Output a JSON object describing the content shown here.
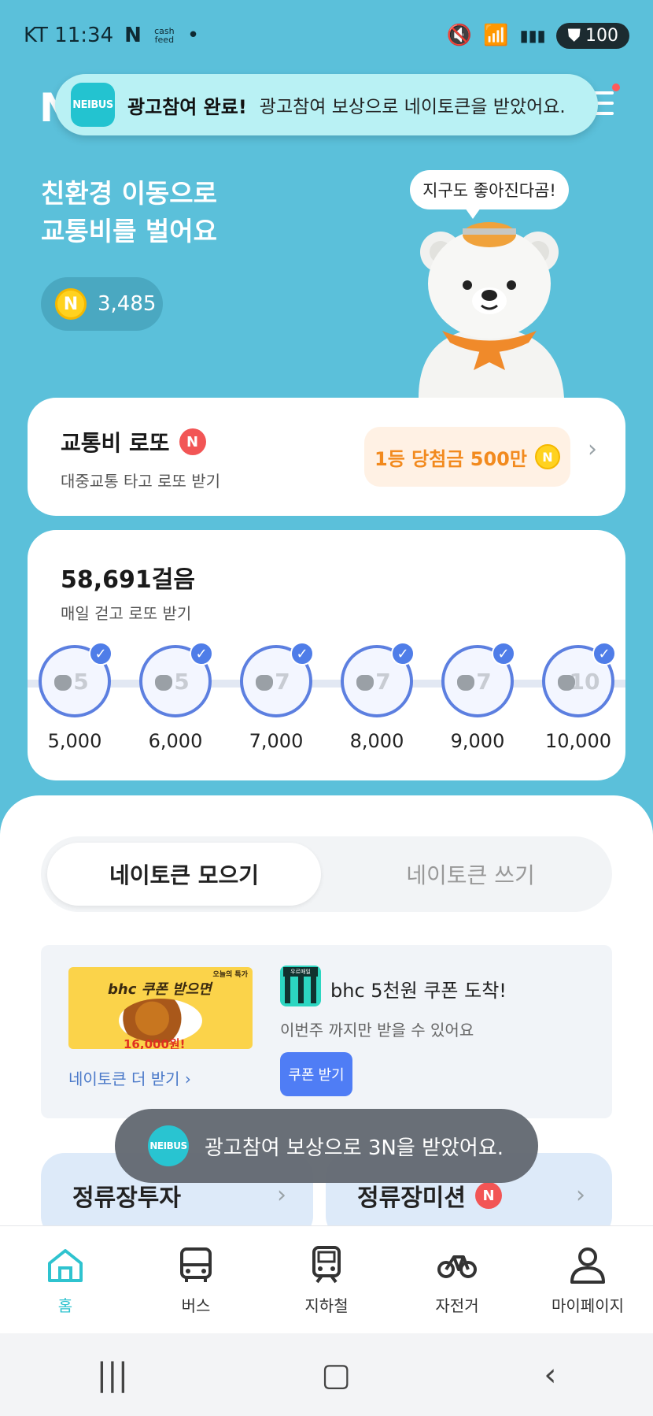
{
  "status_bar": {
    "carrier_time": "KT 11:34",
    "left_icons": [
      "N",
      "cash feed"
    ],
    "battery": "100"
  },
  "header": {
    "logo_partial": "N"
  },
  "toast_top": {
    "app_icon_text": "NEIBUS",
    "bold": "광고참여 완료!",
    "message": "광고참여 보상으로 네이토큰을 받았어요."
  },
  "hero": {
    "title_line1": "친환경 이동으로",
    "title_line2": "교통비를 벌어요",
    "coin_letter": "N",
    "points": "3,485",
    "bubble": "지구도 좋아진다곰!"
  },
  "lotto": {
    "title": "교통비 로또",
    "badge": "N",
    "subtitle": "대중교통 타고 로또 받기",
    "prize": "1등 당첨금 500만",
    "prize_coin": "N"
  },
  "walk": {
    "title": "58,691걸음",
    "subtitle": "매일 걷고 로또 받기",
    "steps": [
      {
        "reward": "5",
        "label": "5,000"
      },
      {
        "reward": "5",
        "label": "6,000"
      },
      {
        "reward": "7",
        "label": "7,000"
      },
      {
        "reward": "7",
        "label": "8,000"
      },
      {
        "reward": "7",
        "label": "9,000"
      },
      {
        "reward": "10",
        "label": "10,000"
      }
    ]
  },
  "tabs": {
    "active": "네이토큰 모으기",
    "inactive": "네이토큰 쓰기"
  },
  "ad": {
    "banner_title": "bhc 쿠폰 받으면",
    "banner_brand": "오늘의 특가",
    "banner_price": "16,000원!",
    "more_link": "네이토큰 더 받기",
    "app_label": "우르매일",
    "title": "bhc 5천원 쿠폰 도착!",
    "subtitle": "이번주 까지만 받을 수 있어요",
    "button": "쿠폰 받기"
  },
  "mini_cards": {
    "left": "정류장투자",
    "right": "정류장미션",
    "right_badge": "N"
  },
  "toast_bottom": {
    "app_icon_text": "NEIBUS",
    "message": "광고참여 보상으로 3N을 받았어요."
  },
  "bottom_nav": {
    "home": "홈",
    "bus": "버스",
    "subway": "지하철",
    "bike": "자전거",
    "mypage": "마이페이지"
  },
  "colors": {
    "background": "#5BC0DA",
    "accent": "#2EC3CF",
    "step_ring": "#5C7FE0",
    "prize_text": "#F28A1E"
  }
}
